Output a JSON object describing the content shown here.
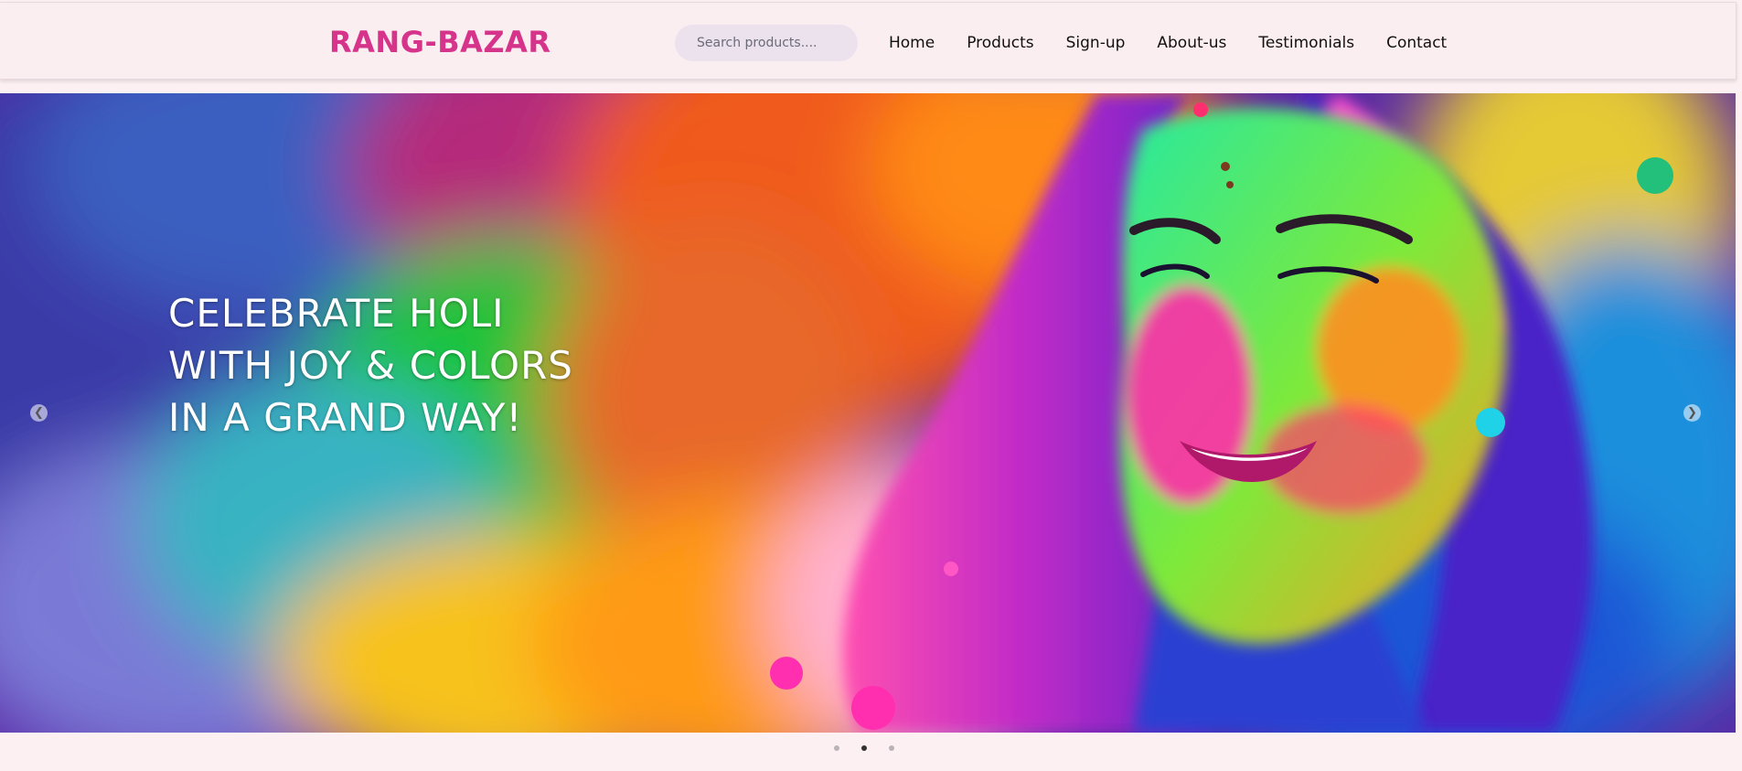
{
  "header": {
    "brand": "RANG-BAZAR",
    "search": {
      "placeholder": "Search products...."
    },
    "nav": [
      "Home",
      "Products",
      "Sign-up",
      "About-us",
      "Testimonials",
      "Contact"
    ]
  },
  "hero": {
    "caption_lines": [
      "CELEBRATE HOLI",
      "WITH JOY & COLORS",
      "IN A GRAND WAY!"
    ],
    "image": "holi-colors-woman-portrait",
    "prev_icon": "chevron-left-icon",
    "next_icon": "chevron-right-icon",
    "slide_count": 3,
    "active_slide": 2
  },
  "colors": {
    "brand": "#d6338a",
    "background": "#fcf0f3",
    "navbar": "#fbeef1",
    "search_bg": "#ece2ee"
  }
}
